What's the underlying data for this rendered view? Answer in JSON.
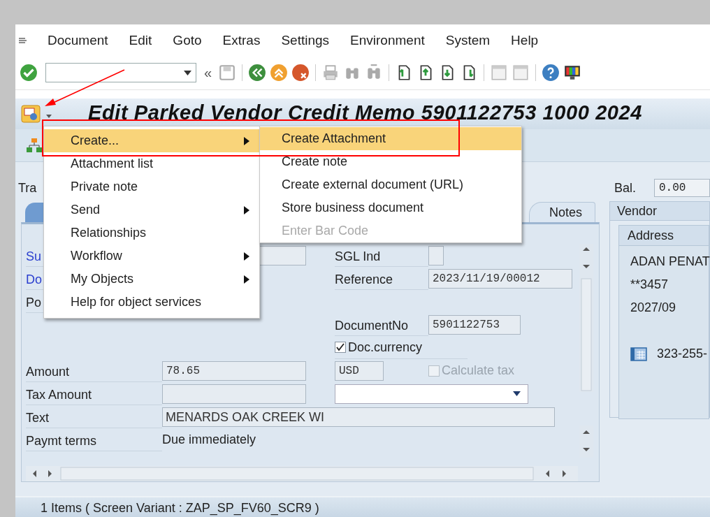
{
  "menu_bar": {
    "items": [
      "Document",
      "Edit",
      "Goto",
      "Extras",
      "Settings",
      "Environment",
      "System",
      "Help"
    ]
  },
  "toolbar": {
    "collapse_glyph": "«"
  },
  "title": "Edit Parked Vendor Credit Memo 5901122753 1000 2024",
  "header": {
    "transaction_label": "Tra",
    "balance_label": "Bal.",
    "balance_value": "0.00"
  },
  "tabs": [
    {
      "label": "Notes",
      "selected": false
    }
  ],
  "form": {
    "rows": [
      {
        "left": [
          {
            "kind": "link",
            "text": "Su"
          },
          {
            "kind": "field"
          }
        ],
        "right": [
          {
            "kind": "label",
            "text": "SGL Ind"
          },
          {
            "kind": "flag"
          }
        ]
      },
      {
        "left": [
          {
            "kind": "link",
            "text": "Do"
          }
        ],
        "right": [
          {
            "kind": "label",
            "text": "Reference"
          },
          {
            "kind": "field",
            "value": "2023/11/19/00012"
          }
        ]
      },
      {
        "left": [
          {
            "kind": "label",
            "text": "Po"
          }
        ],
        "right": []
      },
      {
        "left": [],
        "right": [
          {
            "kind": "label",
            "text": "DocumentNo"
          },
          {
            "kind": "number",
            "value": "5901122753"
          }
        ]
      },
      {
        "left": [],
        "right": [
          {
            "kind": "check",
            "text": "Doc.currency",
            "checked": true,
            "disabled": false
          }
        ]
      },
      {
        "left": [
          {
            "kind": "label",
            "text": "Amount"
          },
          {
            "kind": "field",
            "value": "78.65"
          }
        ],
        "right": [
          {
            "kind": "currency",
            "value": "USD"
          },
          {
            "kind": "check",
            "text": "Calculate tax",
            "checked": false,
            "disabled": true
          }
        ]
      },
      {
        "left": [
          {
            "kind": "label",
            "text": "Tax Amount"
          },
          {
            "kind": "field"
          }
        ],
        "right": [
          {
            "kind": "dropdown"
          }
        ]
      },
      {
        "left": [
          {
            "kind": "label",
            "text": "Text"
          },
          {
            "kind": "textline",
            "value": "MENARDS OAK CREEK WI"
          }
        ],
        "right": []
      },
      {
        "left": [
          {
            "kind": "label",
            "text": "Paymt terms"
          },
          {
            "kind": "value",
            "text": "Due immediately"
          }
        ],
        "right": []
      }
    ]
  },
  "vendor_panel": {
    "title": "Vendor",
    "address_title": "Address",
    "lines": [
      "ADAN PENAT",
      "**3457",
      "2027/09"
    ],
    "phone": "323-255-"
  },
  "context_menu": {
    "items": [
      {
        "label": "Create...",
        "highlighted": true,
        "has_submenu": true
      },
      {
        "label": "Attachment list",
        "highlighted": false,
        "has_submenu": false
      },
      {
        "label": "Private note",
        "highlighted": false,
        "has_submenu": false
      },
      {
        "label": "Send",
        "highlighted": false,
        "has_submenu": true
      },
      {
        "label": "Relationships",
        "highlighted": false,
        "has_submenu": false
      },
      {
        "label": "Workflow",
        "highlighted": false,
        "has_submenu": true
      },
      {
        "label": "My Objects",
        "highlighted": false,
        "has_submenu": true
      },
      {
        "label": "Help for object services",
        "highlighted": false,
        "has_submenu": false
      }
    ]
  },
  "submenu": {
    "items": [
      {
        "label": "Create Attachment",
        "highlighted": true,
        "disabled": false
      },
      {
        "label": "Create note",
        "highlighted": false,
        "disabled": false
      },
      {
        "label": "Create external document (URL)",
        "highlighted": false,
        "disabled": false
      },
      {
        "label": "Store business document",
        "highlighted": false,
        "disabled": false
      },
      {
        "label": "Enter Bar Code",
        "highlighted": false,
        "disabled": true
      }
    ]
  },
  "status_bar": "1 Items ( Screen Variant : ZAP_SP_FV60_SCR9 )"
}
